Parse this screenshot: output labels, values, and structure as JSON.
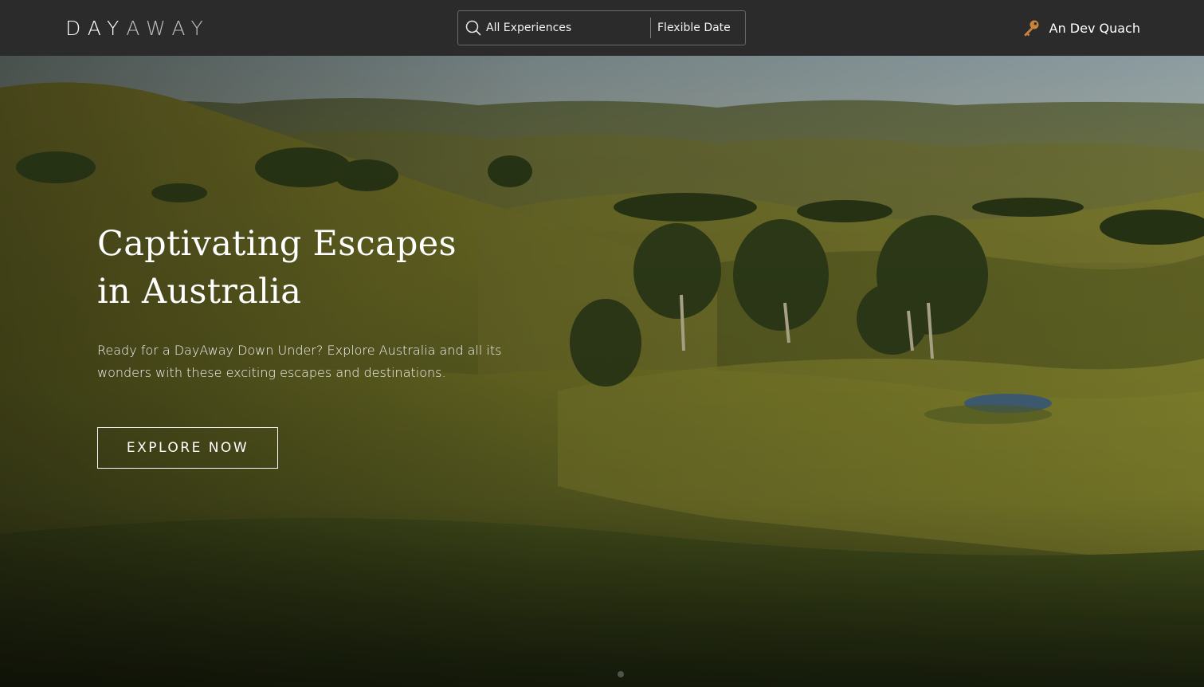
{
  "header": {
    "logo_primary": "DAY",
    "logo_secondary": "AWAY",
    "search_experiences": "All Experiences",
    "search_date": "Flexible Date",
    "search_icon": "search-icon",
    "user_icon": "key-icon",
    "user_name": "An Dev Quach"
  },
  "hero": {
    "title_line1": "Captivating Escapes",
    "title_line2": "in Australia",
    "description": "Ready for a DayAway Down Under? Explore Australia and all its wonders with these exciting escapes and destinations.",
    "cta_label": "EXPLORE NOW"
  },
  "colors": {
    "header_bg": "#2b2b2b",
    "key_icon": "#c8843c",
    "text": "#ffffff"
  }
}
